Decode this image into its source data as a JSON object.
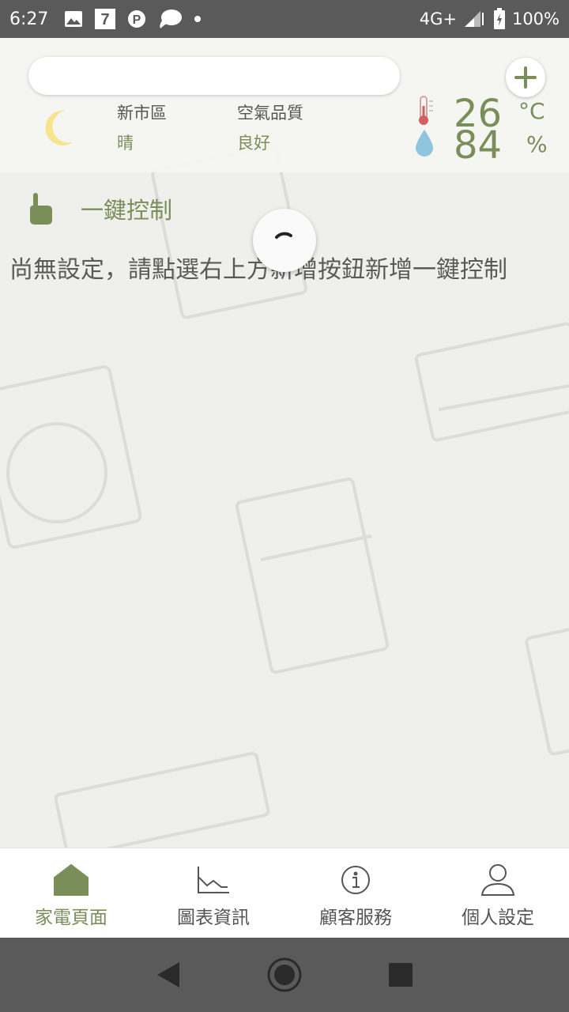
{
  "status_bar": {
    "time": "6:27",
    "network": "4G+",
    "battery": "100%",
    "icons": [
      "gallery-icon",
      "seven-eleven-icon",
      "parking-icon",
      "chat-bubble-icon",
      "dot-icon",
      "signal-icon",
      "battery-icon"
    ]
  },
  "header": {
    "search": {
      "value": "",
      "placeholder": ""
    },
    "weather": {
      "location_label": "新市區",
      "location_value": "晴",
      "air_label": "空氣品質",
      "air_value": "良好",
      "temperature": "26",
      "temperature_unit": "°C",
      "humidity": "84",
      "humidity_unit": "%"
    }
  },
  "section": {
    "title": "一鍵控制",
    "empty_message": "尚無設定，請點選右上方新增按鈕新增一鍵控制"
  },
  "tabs": [
    {
      "label": "家電頁面",
      "icon": "home-icon",
      "active": true
    },
    {
      "label": "圖表資訊",
      "icon": "chart-icon",
      "active": false
    },
    {
      "label": "顧客服務",
      "icon": "info-icon",
      "active": false
    },
    {
      "label": "個人設定",
      "icon": "person-icon",
      "active": false
    }
  ],
  "colors": {
    "accent": "#7a8e5a",
    "status_bar": "#5a5a5a",
    "background": "#efefeb"
  }
}
